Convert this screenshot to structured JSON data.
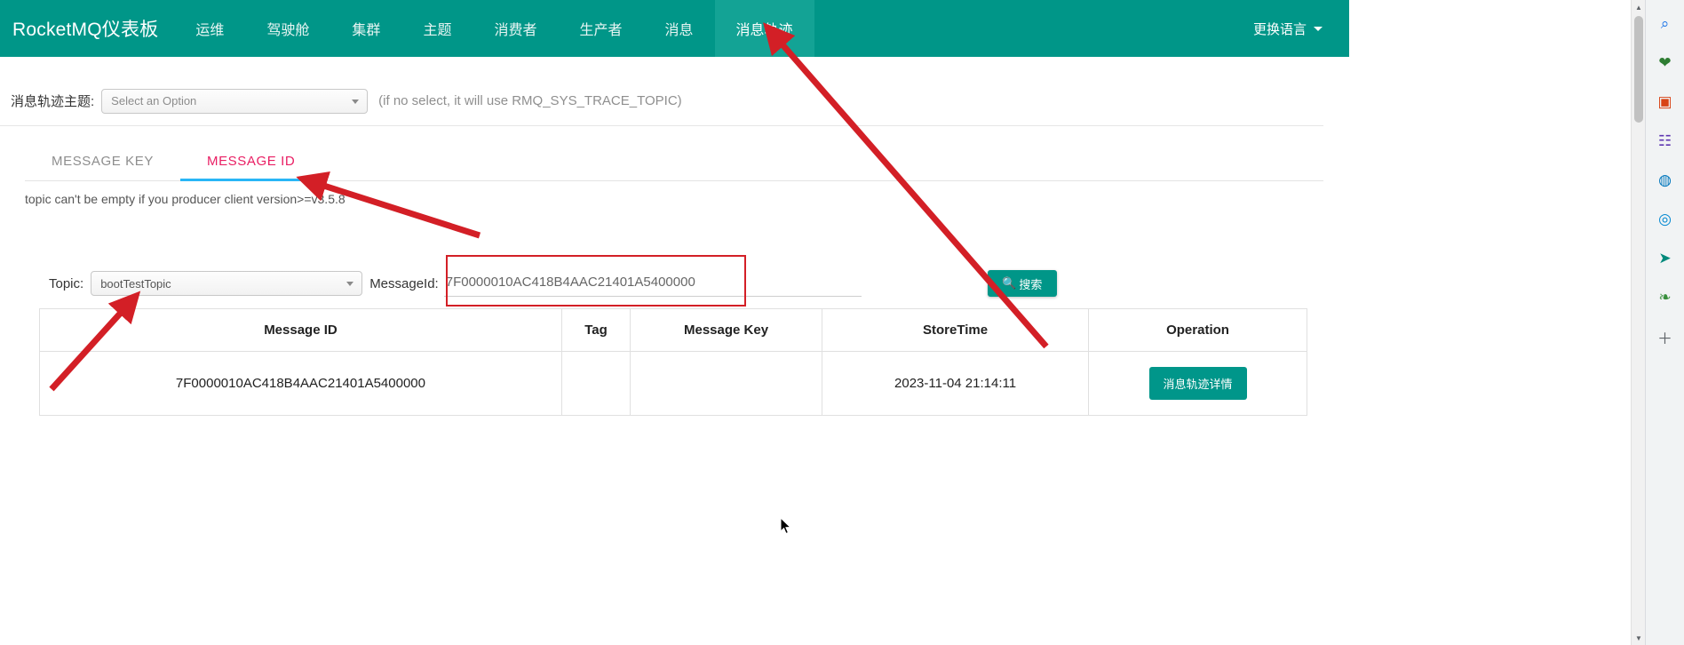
{
  "navbar": {
    "brand": "RocketMQ仪表板",
    "items": [
      {
        "label": "运维",
        "active": false
      },
      {
        "label": "驾驶舱",
        "active": false
      },
      {
        "label": "集群",
        "active": false
      },
      {
        "label": "主题",
        "active": false
      },
      {
        "label": "消费者",
        "active": false
      },
      {
        "label": "生产者",
        "active": false
      },
      {
        "label": "消息",
        "active": false
      },
      {
        "label": "消息轨迹",
        "active": true
      }
    ],
    "language_label": "更换语言",
    "background_color": "#009688",
    "active_background_color": "#13a395"
  },
  "trace_topic": {
    "label": "消息轨迹主题:",
    "select_placeholder": "Select an Option",
    "hint": "(if no select, it will use RMQ_SYS_TRACE_TOPIC)"
  },
  "tabs": [
    {
      "label": "MESSAGE KEY",
      "active": false
    },
    {
      "label": "MESSAGE ID",
      "active": true
    }
  ],
  "tab_underline_color": "#29b6f6",
  "tab_active_color": "#e91e63",
  "form_hint": "topic can't be empty if you producer client version>=v3.5.8",
  "search_form": {
    "topic_label": "Topic:",
    "topic_value": "bootTestTopic",
    "messageid_label": "MessageId:",
    "messageid_value": "7F0000010AC418B4AAC21401A5400000",
    "messageid_placeholder": "",
    "search_button": "搜索",
    "search_icon": "search-icon"
  },
  "table": {
    "headers": [
      "Message ID",
      "Tag",
      "Message Key",
      "StoreTime",
      "Operation"
    ],
    "rows": [
      {
        "message_id": "7F0000010AC418B4AAC21401A5400000",
        "tag": "",
        "message_key": "",
        "store_time": "2023-11-04 21:14:11",
        "operation_label": "消息轨迹详情"
      }
    ]
  },
  "colors": {
    "teal": "#009688",
    "button_teal": "#00968a",
    "annotation_red": "#d31f26"
  },
  "sidebar": {
    "items": [
      {
        "name": "search-icon",
        "glyph": "⌕"
      },
      {
        "name": "bookmark-icon",
        "glyph": "❤"
      },
      {
        "name": "shopping-icon",
        "glyph": "▣"
      },
      {
        "name": "contacts-icon",
        "glyph": "☷"
      },
      {
        "name": "globe-icon",
        "glyph": "◍"
      },
      {
        "name": "outlook-icon",
        "glyph": "◎"
      },
      {
        "name": "telegram-icon",
        "glyph": "➤"
      },
      {
        "name": "leaf-icon",
        "glyph": "❧"
      },
      {
        "name": "add-icon",
        "glyph": "＋"
      }
    ]
  },
  "scrollbar": {
    "up_arrow": "▲",
    "down_arrow": "▼"
  }
}
